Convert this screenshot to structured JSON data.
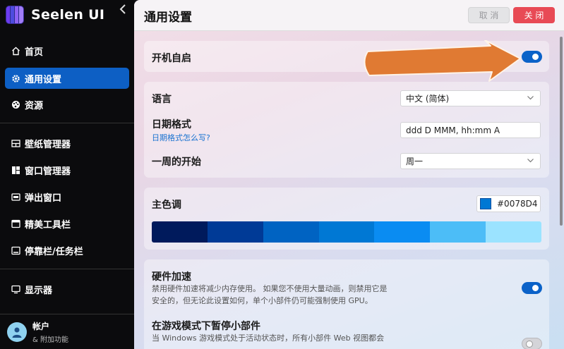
{
  "app": {
    "name": "Seelen UI",
    "collapse_glyph": "‹"
  },
  "sidebar": {
    "items": [
      {
        "label": "首页",
        "icon": "home-icon",
        "active": false
      },
      {
        "label": "通用设置",
        "icon": "gear-icon",
        "active": true
      },
      {
        "label": "资源",
        "icon": "palette-icon",
        "active": false
      },
      {
        "label": "壁纸管理器",
        "icon": "wallpaper-icon",
        "active": false
      },
      {
        "label": "窗口管理器",
        "icon": "window-tiles-icon",
        "active": false
      },
      {
        "label": "弹出窗口",
        "icon": "popup-icon",
        "active": false
      },
      {
        "label": "精美工具栏",
        "icon": "toolbar-icon",
        "active": false
      },
      {
        "label": "停靠栏/任务栏",
        "icon": "dock-icon",
        "active": false
      },
      {
        "label": "显示器",
        "icon": "monitor-icon",
        "active": false
      }
    ],
    "account": {
      "title": "帐户",
      "subtitle": "& 附加功能"
    }
  },
  "header": {
    "title": "通用设置",
    "cancel_label": "取 消",
    "close_label": "关 闭"
  },
  "settings": {
    "autostart": {
      "label": "开机自启",
      "enabled": true
    },
    "language": {
      "label": "语言",
      "value": "中文 (简体)"
    },
    "date_format": {
      "label": "日期格式",
      "help_link": "日期格式怎么写?",
      "value": "ddd D MMM, hh:mm A"
    },
    "week_start": {
      "label": "一周的开始",
      "value": "周一"
    },
    "accent": {
      "label": "主色调",
      "hex": "#0078D4",
      "palette": [
        "#001a5c",
        "#003a96",
        "#0063c2",
        "#0078d4",
        "#0a8cf2",
        "#4cbdf7",
        "#9be3ff"
      ]
    },
    "hardware_acceleration": {
      "label": "硬件加速",
      "description_line1": "禁用硬件加速将减少内存使用。 如果您不使用大量动画，则禁用它是",
      "description_line2": "安全的，但无论此设置如何，单个小部件仍可能强制使用 GPU。",
      "enabled": true
    },
    "pause_in_game": {
      "label": "在游戏模式下暂停小部件",
      "description_line1": "当 Windows 游戏模式处于活动状态时，所有小部件 Web 视图都会",
      "enabled": false
    }
  },
  "colors": {
    "accent": "#0b62c8",
    "close": "#e84a55",
    "annotation_arrow": "#e07a33"
  }
}
